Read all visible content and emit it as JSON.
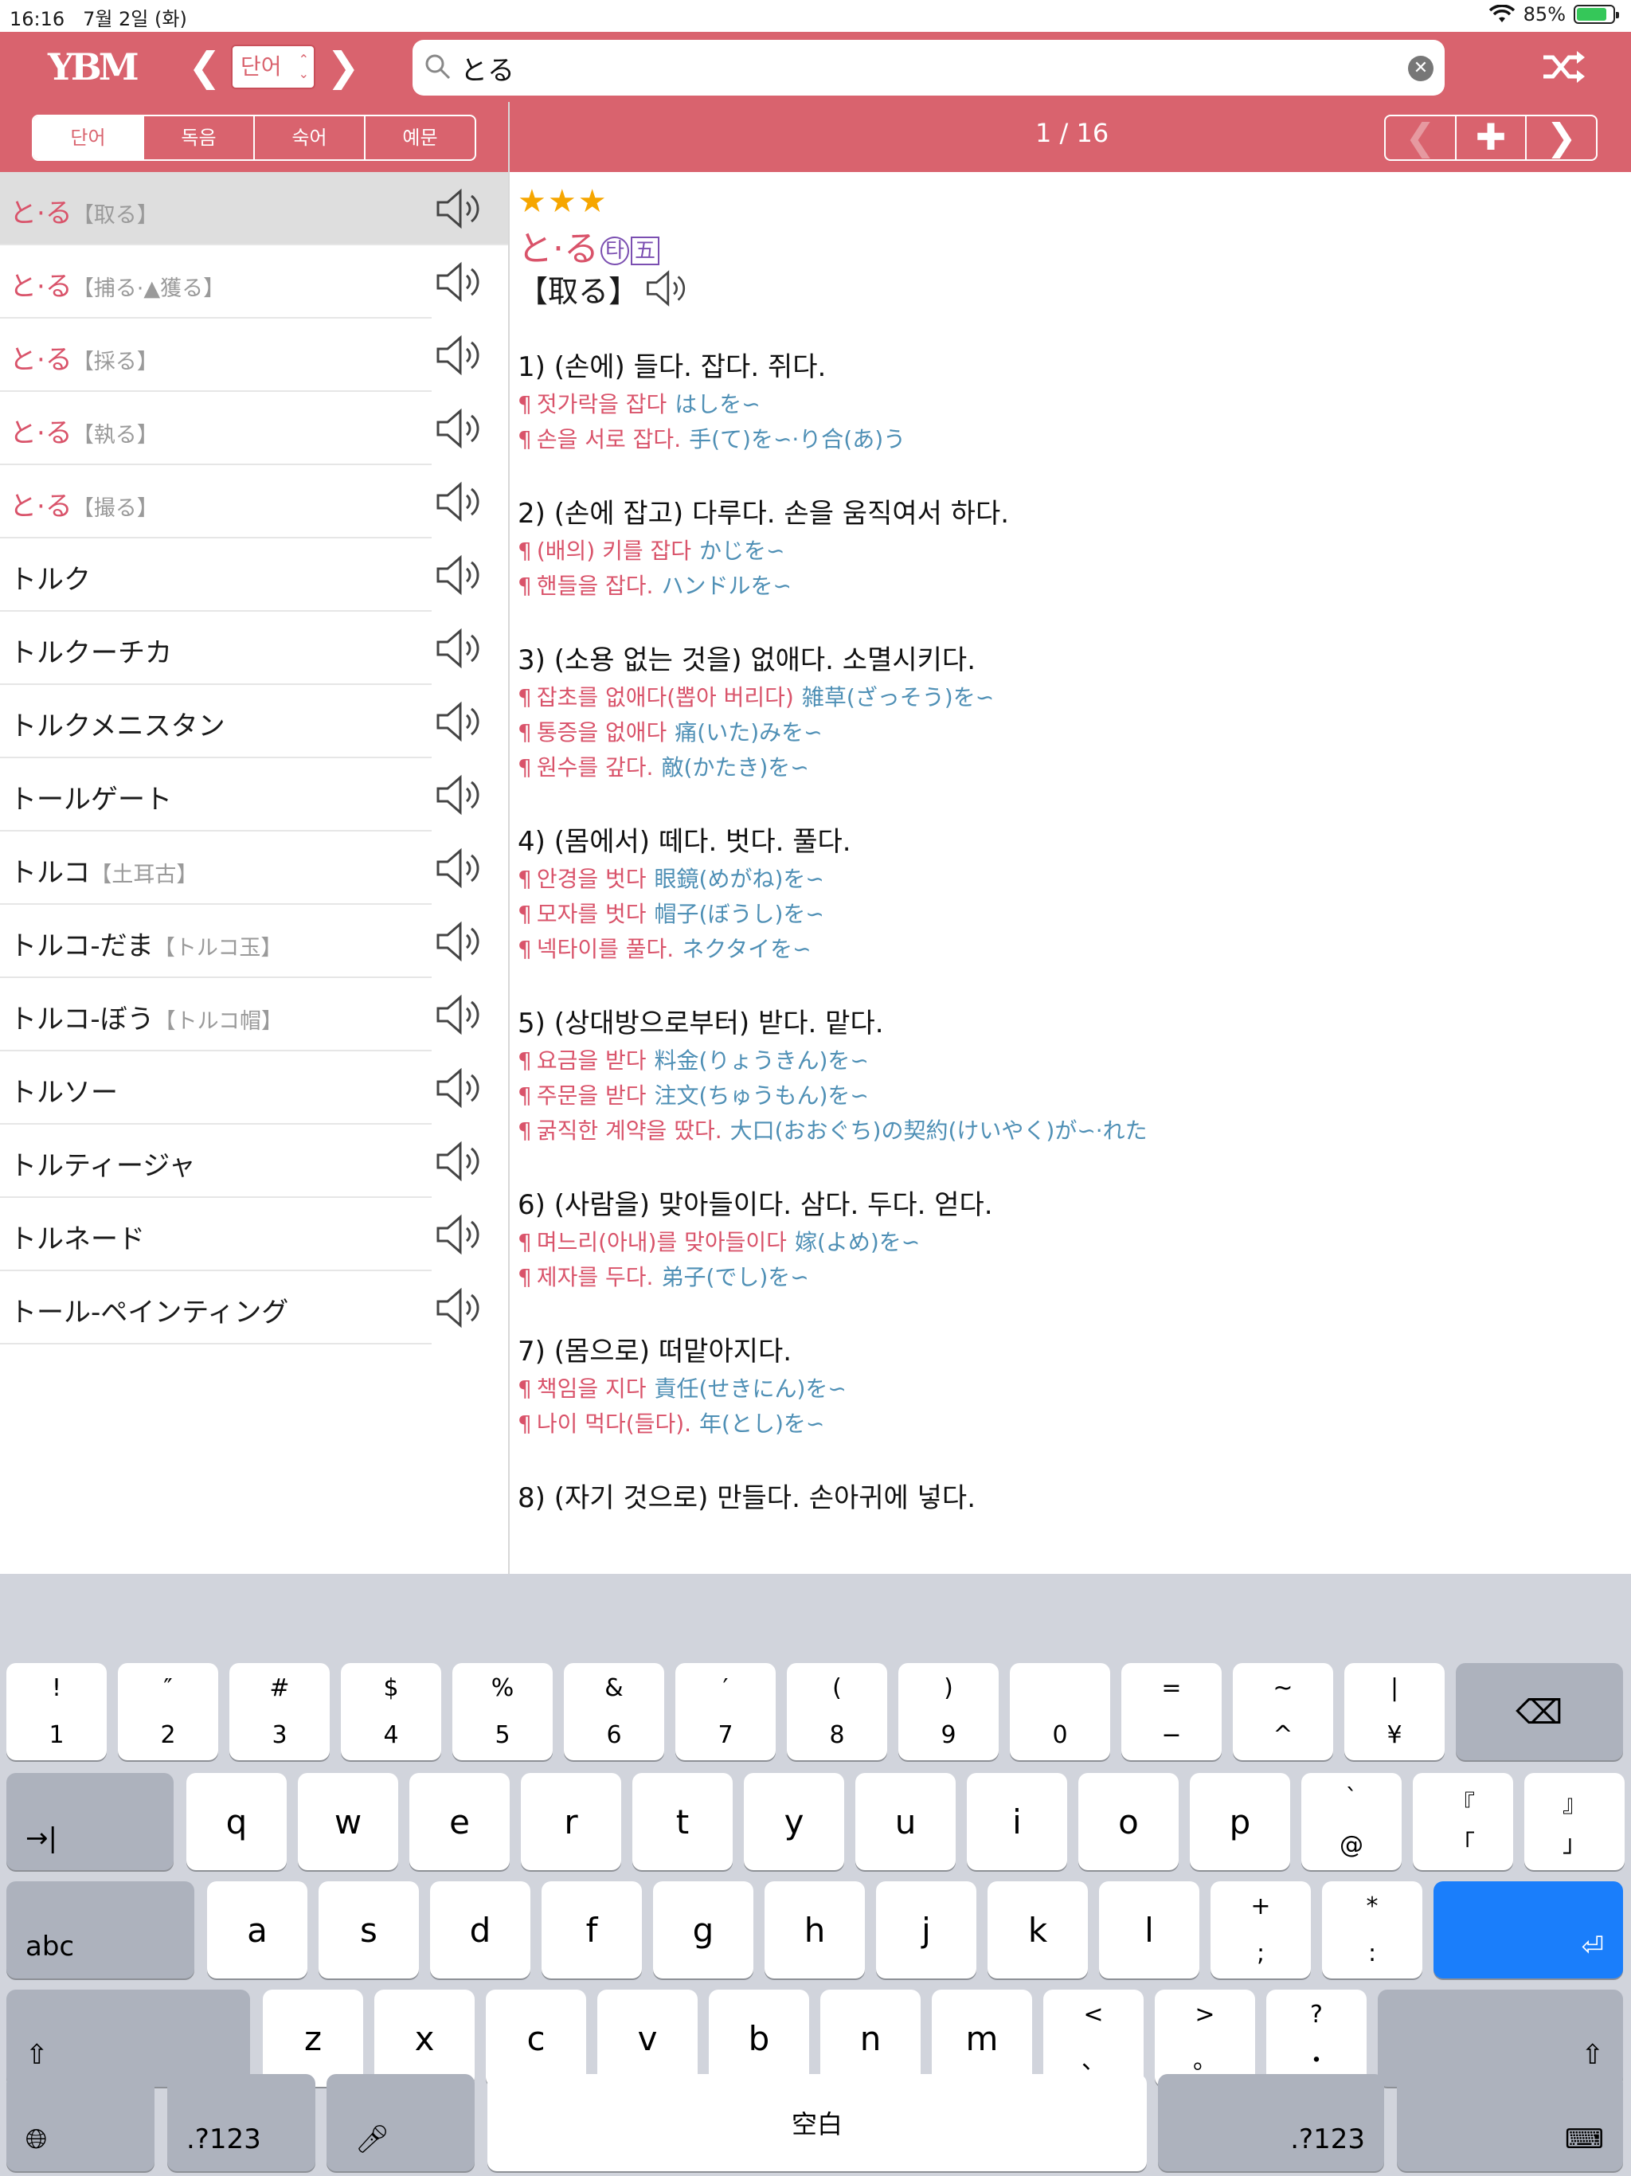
{
  "status": {
    "time": "16:16",
    "date": "7월 2일 (화)",
    "battery": "85%",
    "battery_level": 0.85
  },
  "nav": {
    "logo": "YBM",
    "mode": "단어",
    "search_value": "とる",
    "back_icon": "chevron-left-icon",
    "forward_icon": "chevron-right-icon",
    "shuffle_icon": "shuffle-icon"
  },
  "tabs": [
    "단어",
    "독음",
    "숙어",
    "예문"
  ],
  "pager": {
    "label": "1 / 16"
  },
  "colors": {
    "accent": "#d9636e",
    "headword_red": "#d9536a",
    "japanese_blue": "#4e8fb5",
    "stars": "#f6a600",
    "badge": "#7b4fb1",
    "enter_key": "#1a7efb"
  },
  "wordlist": [
    {
      "word": "と·る",
      "kanji": "【取る】",
      "red": true,
      "selected": true
    },
    {
      "word": "と·る",
      "kanji": "【捕る·▲獲る】",
      "red": true
    },
    {
      "word": "と·る",
      "kanji": "【採る】",
      "red": true
    },
    {
      "word": "と·る",
      "kanji": "【執る】",
      "red": true
    },
    {
      "word": "と·る",
      "kanji": "【撮る】",
      "red": true
    },
    {
      "word": "トルク",
      "kanji": ""
    },
    {
      "word": "トルクーチカ",
      "kanji": ""
    },
    {
      "word": "トルクメニスタン",
      "kanji": ""
    },
    {
      "word": "トールゲート",
      "kanji": ""
    },
    {
      "word": "トルコ",
      "kanji": "【土耳古】"
    },
    {
      "word": "トルコ-だま",
      "kanji": "【トルコ玉】"
    },
    {
      "word": "トルコ-ぼう",
      "kanji": "【トルコ帽】"
    },
    {
      "word": "トルソー",
      "kanji": ""
    },
    {
      "word": "トルティージャ",
      "kanji": ""
    },
    {
      "word": "トルネード",
      "kanji": ""
    },
    {
      "word": "トール-ペインティング",
      "kanji": ""
    }
  ],
  "entry": {
    "stars": "★★★",
    "headword": "と·る",
    "badge1": "타",
    "badge2": "五",
    "kanji": "【取る】",
    "senses": [
      {
        "def": "1) (손에) 들다. 잡다. 쥐다.",
        "examples": [
          {
            "ko": "젓가락을 잡다",
            "ja": "はしを∽"
          },
          {
            "ko": "손을 서로 잡다.",
            "ja": "手(て)を∽·り合(あ)う"
          }
        ]
      },
      {
        "def": "2) (손에 잡고) 다루다. 손을 움직여서 하다.",
        "examples": [
          {
            "ko": "(배의) 키를 잡다",
            "ja": "かじを∽"
          },
          {
            "ko": "핸들을 잡다.",
            "ja": "ハンドルを∽"
          }
        ]
      },
      {
        "def": "3) (소용 없는 것을) 없애다. 소멸시키다.",
        "examples": [
          {
            "ko": "잡초를 없애다(뽑아 버리다)",
            "ja": "雑草(ざっそう)を∽"
          },
          {
            "ko": "통증을 없애다",
            "ja": "痛(いた)みを∽"
          },
          {
            "ko": "원수를 갚다.",
            "ja": "敵(かたき)を∽"
          }
        ]
      },
      {
        "def": "4) (몸에서) 떼다. 벗다. 풀다.",
        "examples": [
          {
            "ko": "안경을 벗다",
            "ja": "眼鏡(めがね)を∽"
          },
          {
            "ko": "모자를 벗다",
            "ja": "帽子(ぼうし)を∽"
          },
          {
            "ko": "넥타이를 풀다.",
            "ja": "ネクタイを∽"
          }
        ]
      },
      {
        "def": "5) (상대방으로부터) 받다. 맡다.",
        "examples": [
          {
            "ko": "요금을 받다",
            "ja": "料金(りょうきん)を∽"
          },
          {
            "ko": "주문을 받다",
            "ja": "注文(ちゅうもん)を∽"
          },
          {
            "ko": "굵직한 계약을 땄다.",
            "ja": "大口(おおぐち)の契約(けいやく)が∽·れた"
          }
        ]
      },
      {
        "def": "6) (사람을) 맞아들이다. 삼다. 두다. 얻다.",
        "examples": [
          {
            "ko": "며느리(아내)를 맞아들이다",
            "ja": "嫁(よめ)を∽"
          },
          {
            "ko": "제자를 두다.",
            "ja": "弟子(でし)を∽"
          }
        ]
      },
      {
        "def": "7) (몸으로) 떠맡아지다.",
        "examples": [
          {
            "ko": "책임을 지다",
            "ja": "責任(せきにん)を∽"
          },
          {
            "ko": "나이 먹다(들다).",
            "ja": "年(とし)を∽"
          }
        ]
      },
      {
        "def": "8) (자기 것으로) 만들다. 손아귀에 넣다.",
        "examples": []
      }
    ]
  },
  "keyboard": {
    "row1": [
      [
        "!",
        "1"
      ],
      [
        "″",
        "2"
      ],
      [
        "#",
        "3"
      ],
      [
        "$",
        "4"
      ],
      [
        "%",
        "5"
      ],
      [
        "&",
        "6"
      ],
      [
        "′",
        "7"
      ],
      [
        "(",
        "8"
      ],
      [
        ")",
        "9"
      ],
      [
        "",
        "0"
      ],
      [
        "=",
        "−"
      ],
      [
        "~",
        "^"
      ],
      [
        "|",
        "¥"
      ]
    ],
    "row2": [
      "q",
      "w",
      "e",
      "r",
      "t",
      "y",
      "u",
      "i",
      "o",
      "p"
    ],
    "row2_extra": [
      [
        "`",
        "@"
      ],
      [
        "『",
        "「"
      ],
      [
        "』",
        "」"
      ]
    ],
    "row3": [
      "a",
      "s",
      "d",
      "f",
      "g",
      "h",
      "j",
      "k",
      "l"
    ],
    "row3_extra": [
      [
        "+",
        ";"
      ],
      [
        "*",
        ":"
      ]
    ],
    "row4": [
      "z",
      "x",
      "c",
      "v",
      "b",
      "n",
      "m"
    ],
    "row4_extra": [
      [
        "<",
        "、"
      ],
      [
        ">",
        "。"
      ],
      [
        "?",
        "・"
      ]
    ],
    "tab_label": "→|",
    "abc_label": "abc",
    "num_label": ".?123",
    "space_label": "空白"
  }
}
